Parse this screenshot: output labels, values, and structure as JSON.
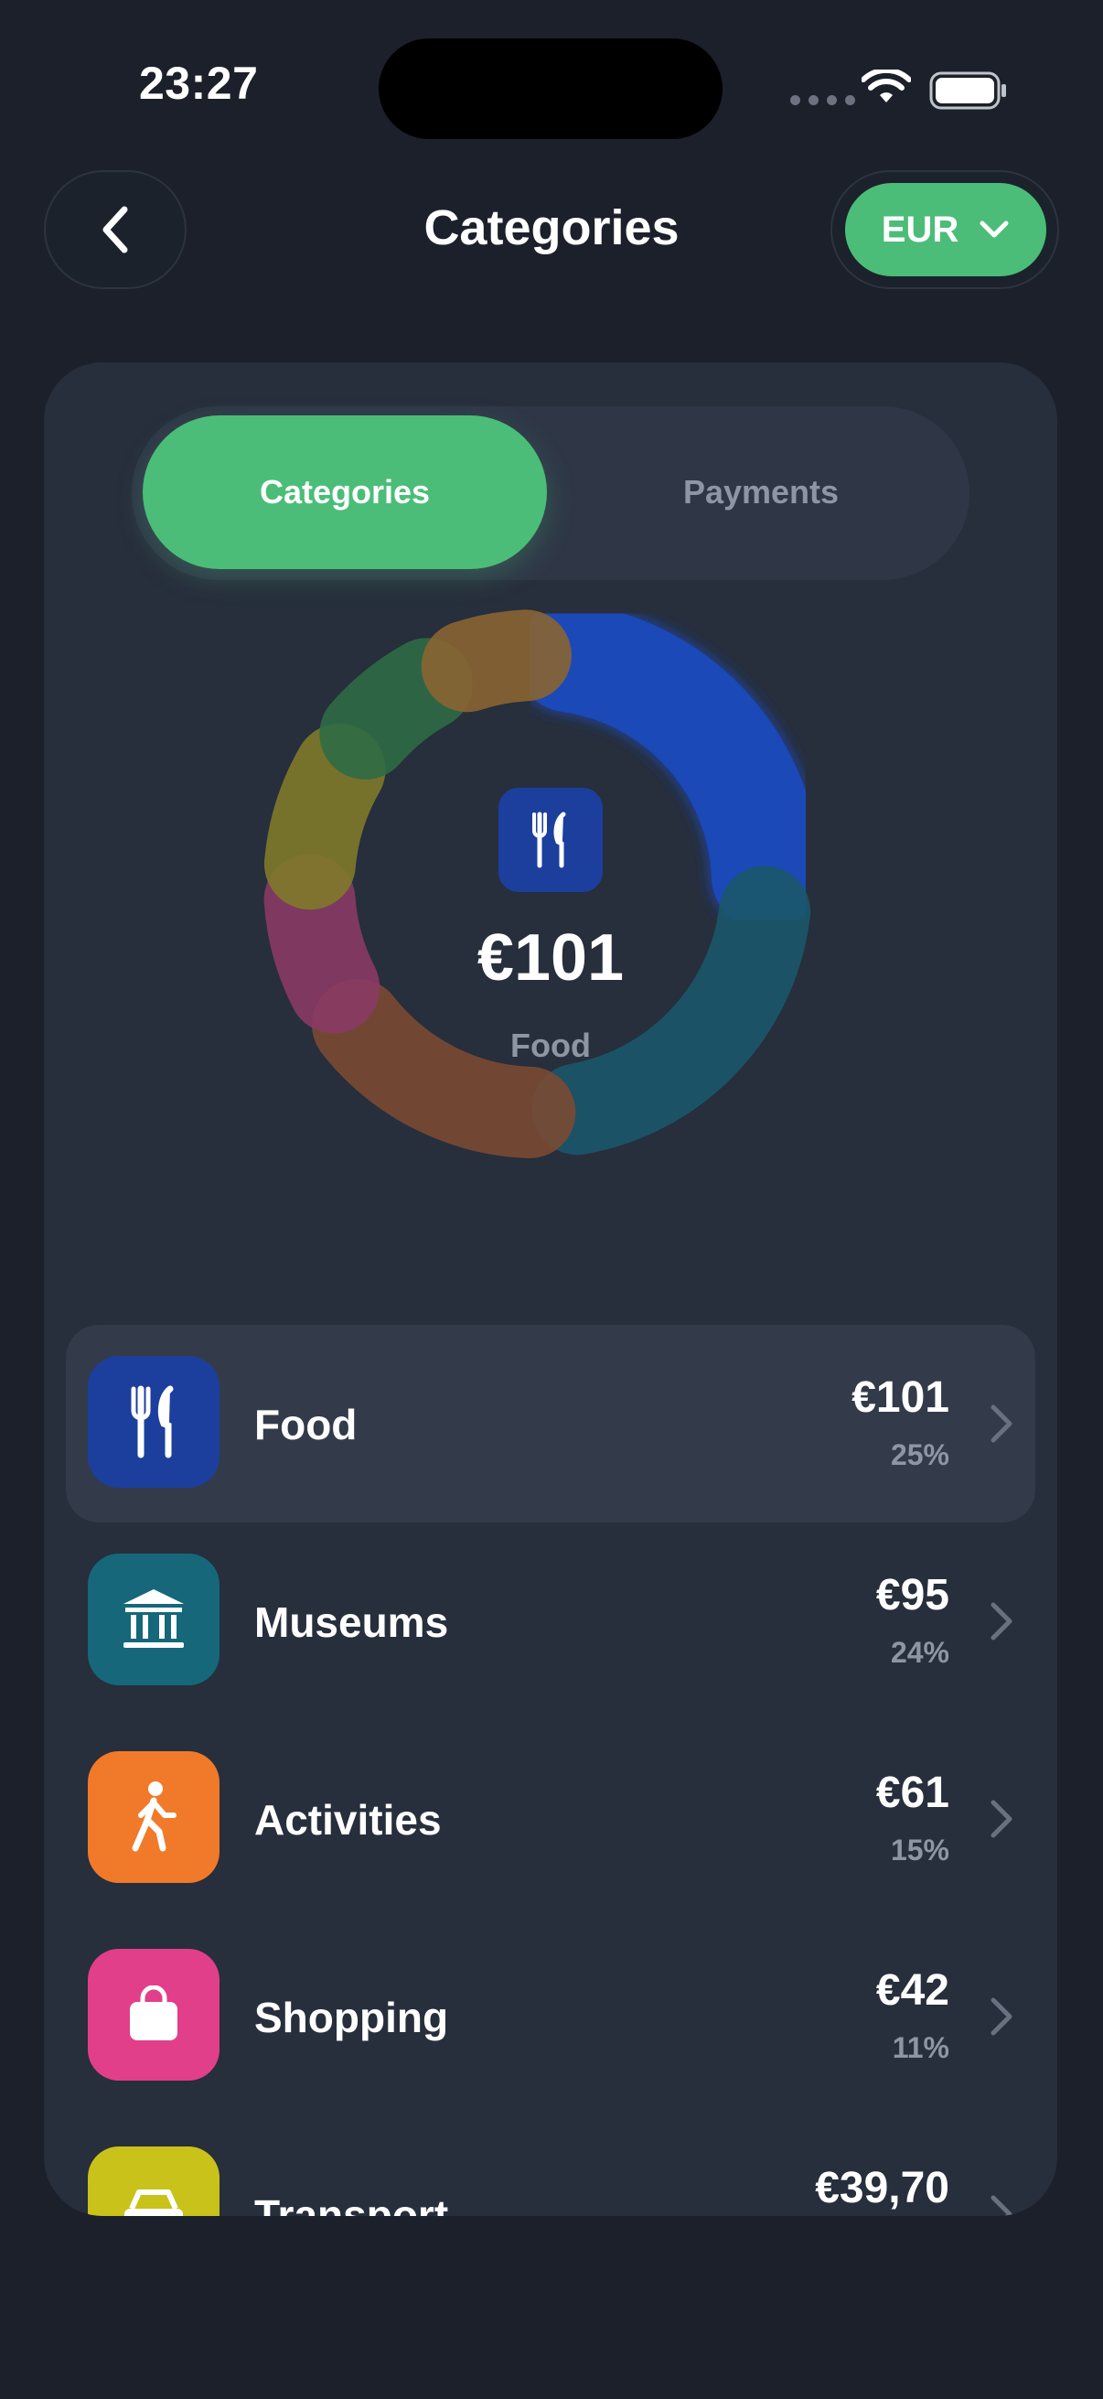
{
  "status": {
    "time": "23:27"
  },
  "header": {
    "title": "Categories",
    "currency": "EUR"
  },
  "tabs": [
    {
      "label": "Categories",
      "active": true
    },
    {
      "label": "Payments",
      "active": false
    }
  ],
  "summary": {
    "amount": "€101",
    "label": "Food"
  },
  "categories": [
    {
      "name": "Food",
      "amount": "€101",
      "percent": "25%",
      "icon": "fork-knife-icon",
      "color": "#1c3f9e",
      "selected": true
    },
    {
      "name": "Museums",
      "amount": "€95",
      "percent": "24%",
      "icon": "museum-icon",
      "color": "#16677a",
      "selected": false
    },
    {
      "name": "Activities",
      "amount": "€61",
      "percent": "15%",
      "icon": "walking-icon",
      "color": "#f07a2a",
      "selected": false
    },
    {
      "name": "Shopping",
      "amount": "€42",
      "percent": "11%",
      "icon": "shopping-bag-icon",
      "color": "#e13f8a",
      "selected": false
    },
    {
      "name": "Transport",
      "amount": "€39,70",
      "percent": "",
      "icon": "car-icon",
      "color": "#c8c21a",
      "selected": false
    }
  ],
  "donut_colors": {
    "food": "#1d48b8",
    "museums": "#1b5669",
    "activities": "#7a4a33",
    "shopping": "#8a3a64",
    "transport": "#7f7a2a",
    "green": "#2f6b45",
    "orange": "#8a6432"
  }
}
